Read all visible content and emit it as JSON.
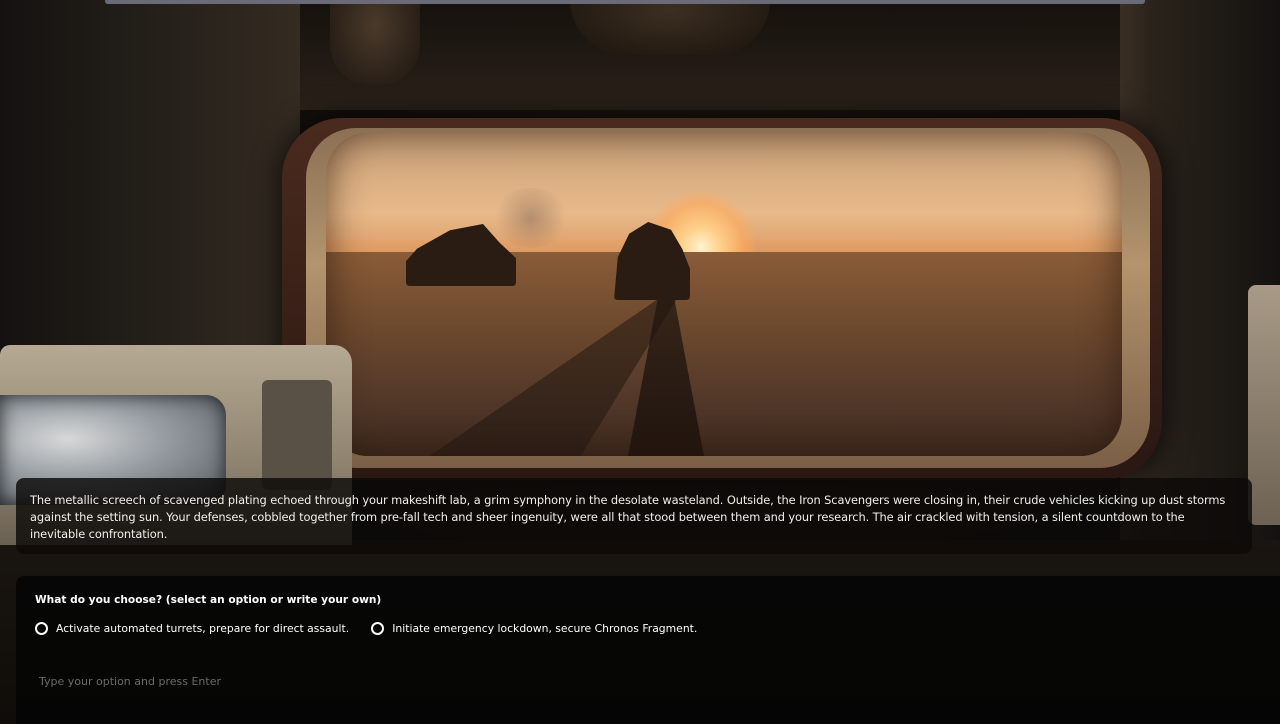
{
  "story": {
    "narrative": "The metallic screech of scavenged plating echoed through your makeshift lab, a grim symphony in the desolate wasteland. Outside, the Iron Scavengers were closing in, their crude vehicles kicking up dust storms against the setting sun. Your defenses, cobbled together from pre-fall tech and sheer ingenuity, were all that stood between them and your research. The air crackled with tension, a silent countdown to the inevitable confrontation."
  },
  "choices": {
    "prompt": "What do you choose? (select an option or write your own)",
    "options": [
      {
        "label": "Activate automated turrets, prepare for direct assault."
      },
      {
        "label": "Initiate emergency lockdown, secure Chronos Fragment."
      }
    ],
    "input": {
      "placeholder": "Type your option and press Enter",
      "value": ""
    }
  },
  "colors": {
    "panel_background": "#050505",
    "text": "#ffffff",
    "placeholder": "#6c6a66"
  }
}
